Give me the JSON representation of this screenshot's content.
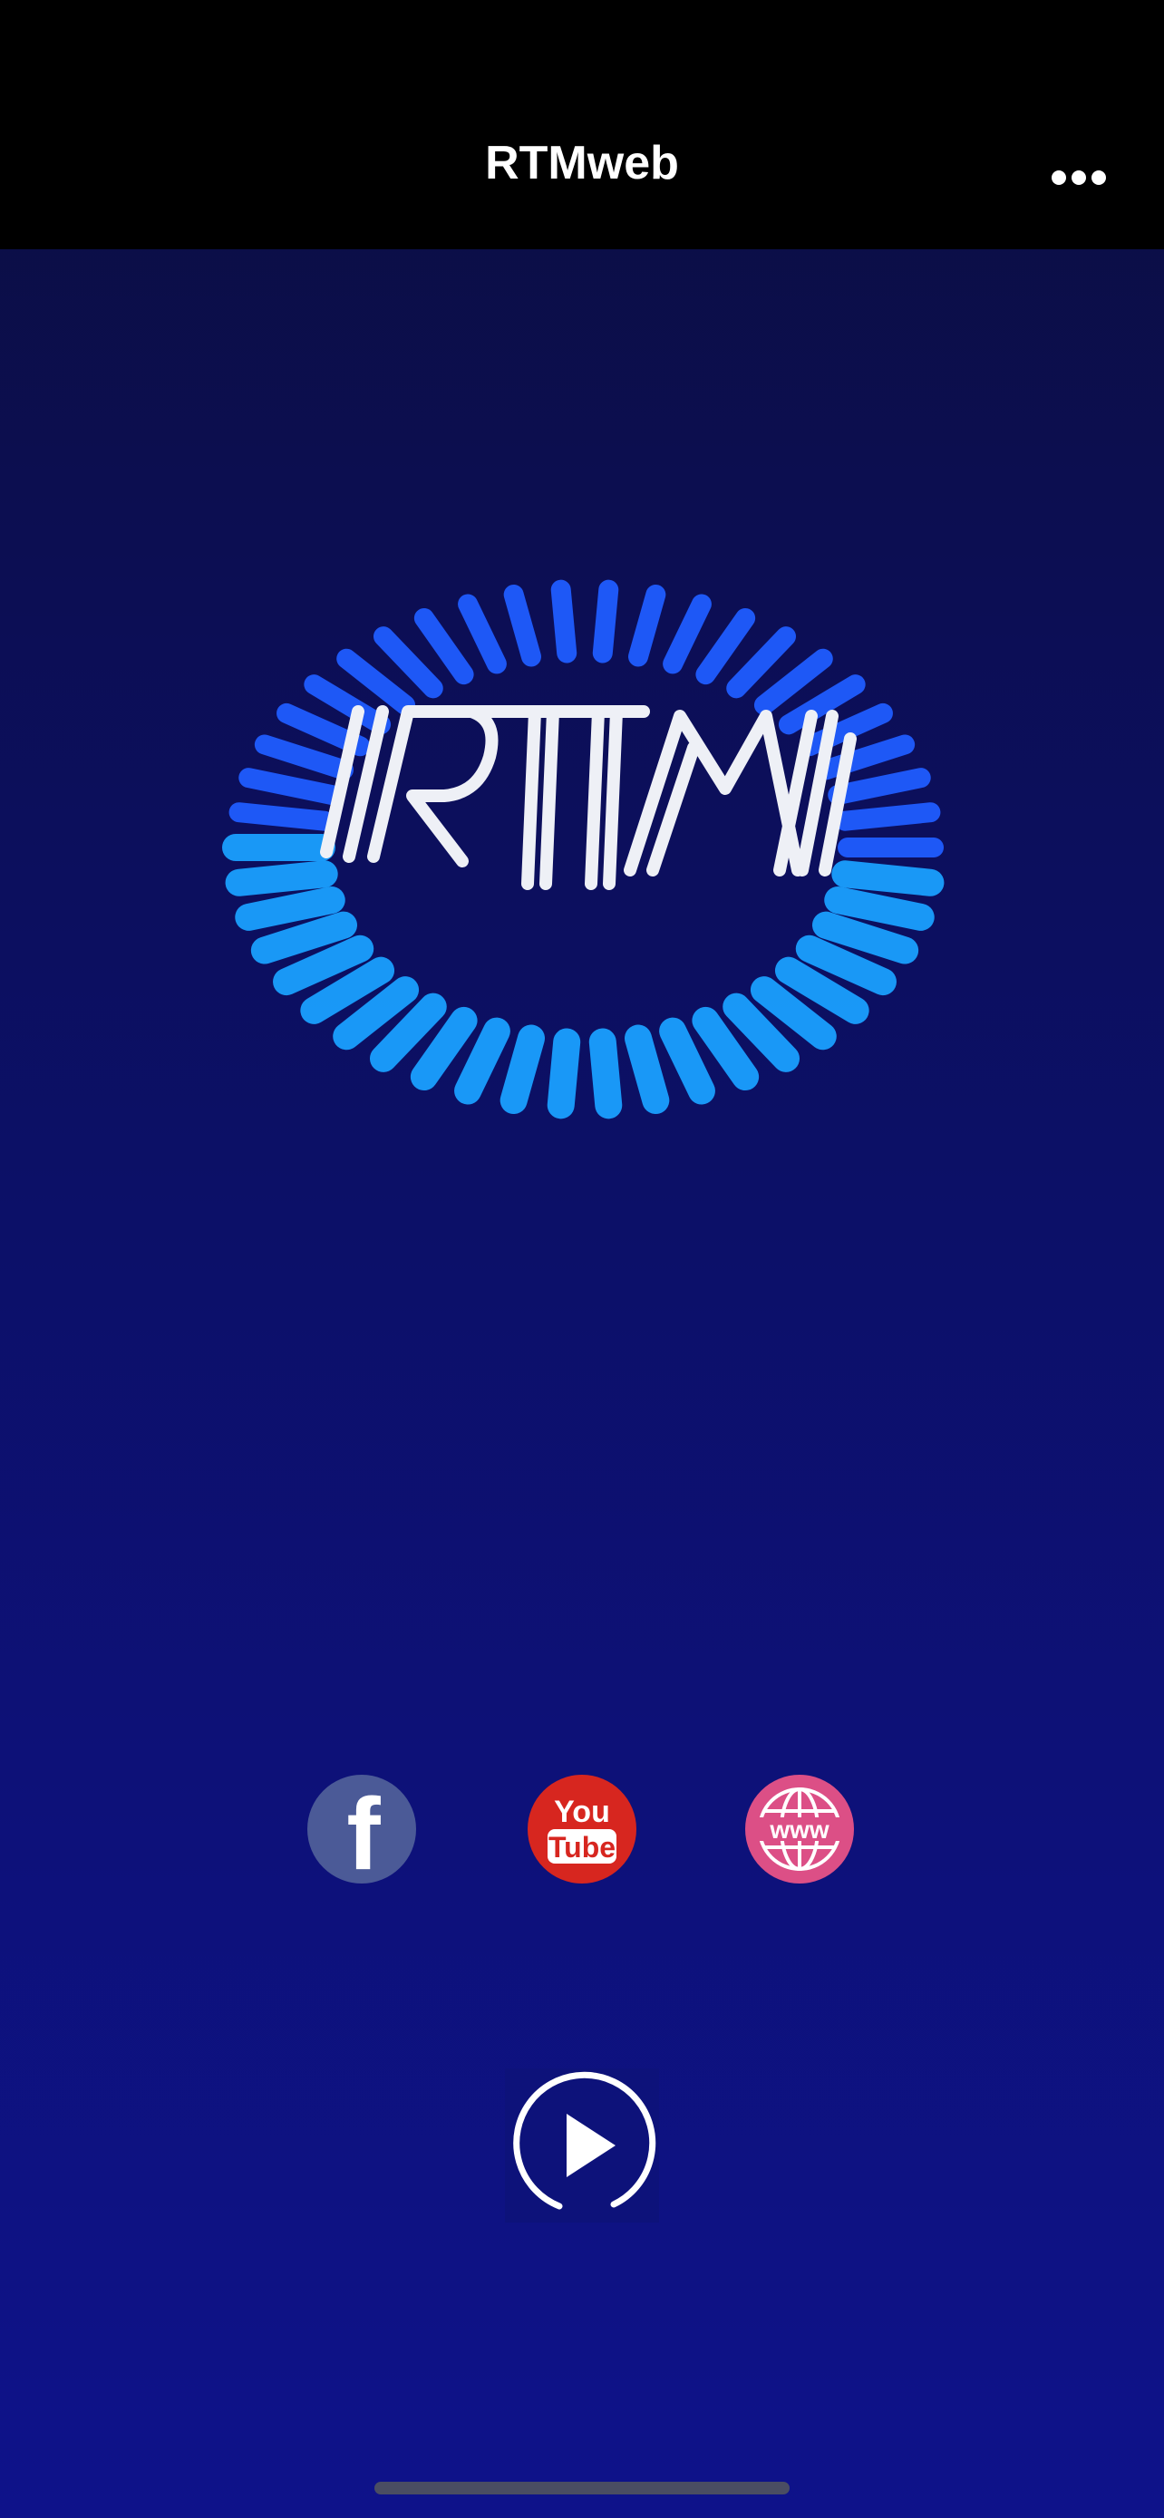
{
  "nav": {
    "title": "RTMweb",
    "more_icon": "ellipsis-icon"
  },
  "logo": {
    "text": "RTM",
    "icon": "rtm-logo"
  },
  "social": [
    {
      "name": "facebook",
      "icon": "facebook-icon",
      "glyph": "f",
      "color": "#4b5a97"
    },
    {
      "name": "youtube",
      "icon": "youtube-icon",
      "line1": "You",
      "line2": "Tube",
      "color": "#d7261f"
    },
    {
      "name": "website",
      "icon": "globe-www-icon",
      "glyph": "www",
      "color": "#dc4f86"
    }
  ],
  "player": {
    "play_icon": "play-icon"
  },
  "colors": {
    "nav_bg": "#000000",
    "bg_top": "#0b0d3f",
    "bg_bottom": "#0e128a",
    "accent": "#1a8cff"
  }
}
